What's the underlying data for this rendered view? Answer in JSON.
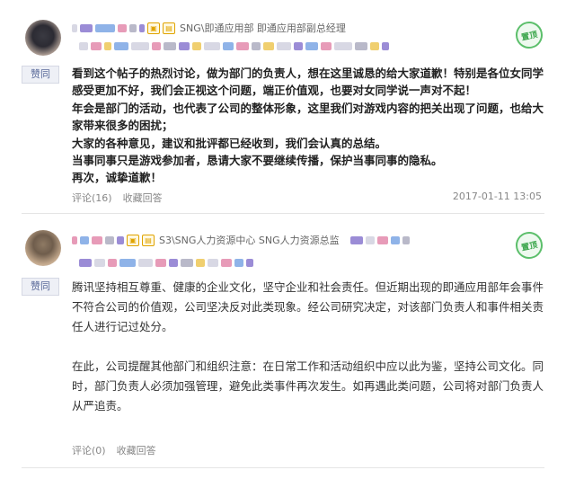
{
  "posts": [
    {
      "author_dept": "SNG\\即通应用部 即通应用部副总经理",
      "badge_icon": "vip-badge-icon",
      "stamp": "置顶",
      "tag": "赞同",
      "lines": [
        "看到这个帖子的热烈讨论，做为部门的负责人，想在这里诚恳的给大家道歉！特别是各位女同学",
        "感受更加不好，我们会正视这个问题，端正价值观，也要对女同学说一声对不起！",
        "年会是部门的活动，也代表了公司的整体形象，这里我们对游戏内容的把关出现了问题，也给大",
        "家带来很多的困扰；",
        "大家的各种意见，建议和批评都已经收到，我们会认真的总结。",
        "当事同事只是游戏参加者，恳请大家不要继续传播，保护当事同事的隐私。",
        "再次，诚挚道歉！"
      ],
      "comment_label": "评论(16)",
      "favorite_label": "收藏回答",
      "timestamp": "2017-01-11 13:05"
    },
    {
      "author_dept": "S3\\SNG人力资源中心 SNG人力资源总监",
      "badge_icon": "vip-badge-icon",
      "stamp": "置顶",
      "tag": "赞同",
      "para1": [
        "腾讯坚持相互尊重、健康的企业文化，坚守企业和社会责任。但近期出现的即通应用部年会事件",
        "不符合公司的价值观，公司坚决反对此类现象。经公司研究决定，对该部门负责人和事件相关责",
        "任人进行记过处分。"
      ],
      "para2": [
        "在此，公司提醒其他部门和组织注意：在日常工作和活动组织中应以此为鉴，坚持公司文化。同",
        "时，部门负责人必须加强管理，避免此类事件再次发生。如再遇此类问题，公司将对部门负责人",
        "从严追责。"
      ],
      "comment_label": "评论(0)",
      "favorite_label": "收藏回答"
    }
  ],
  "colors": {
    "tag_text": "#5a6a9a",
    "stamp": "#3aa64b",
    "badge": "#e0a300"
  }
}
